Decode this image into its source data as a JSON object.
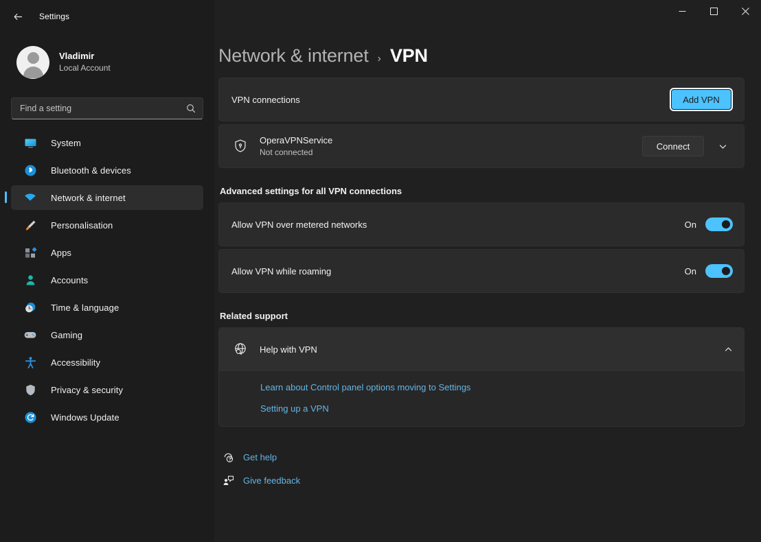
{
  "window": {
    "title": "Settings",
    "back_icon": "back-arrow-icon",
    "minimize_label": "Minimize",
    "maximize_label": "Maximize",
    "close_label": "Close"
  },
  "profile": {
    "name": "Vladimir",
    "account_type": "Local Account",
    "avatar_icon": "user-avatar-icon"
  },
  "search": {
    "placeholder": "Find a setting",
    "value": "",
    "icon": "search-icon"
  },
  "sidebar": {
    "items": [
      {
        "label": "System",
        "icon": "system-monitor-icon",
        "selected": false
      },
      {
        "label": "Bluetooth & devices",
        "icon": "bluetooth-icon",
        "selected": false
      },
      {
        "label": "Network & internet",
        "icon": "wifi-icon",
        "selected": true
      },
      {
        "label": "Personalisation",
        "icon": "paintbrush-icon",
        "selected": false
      },
      {
        "label": "Apps",
        "icon": "apps-icon",
        "selected": false
      },
      {
        "label": "Accounts",
        "icon": "account-person-icon",
        "selected": false
      },
      {
        "label": "Time & language",
        "icon": "clock-globe-icon",
        "selected": false
      },
      {
        "label": "Gaming",
        "icon": "gamepad-icon",
        "selected": false
      },
      {
        "label": "Accessibility",
        "icon": "accessibility-person-icon",
        "selected": false
      },
      {
        "label": "Privacy & security",
        "icon": "shield-icon",
        "selected": false
      },
      {
        "label": "Windows Update",
        "icon": "update-refresh-icon",
        "selected": false
      }
    ]
  },
  "breadcrumb": {
    "parent": "Network & internet",
    "separator": "›",
    "current": "VPN"
  },
  "vpn_connections": {
    "title": "VPN connections",
    "add_button": "Add VPN"
  },
  "connection": {
    "icon": "vpn-shield-icon",
    "name": "OperaVPNService",
    "status": "Not connected",
    "connect_button": "Connect",
    "expand_icon": "chevron-down-icon"
  },
  "advanced": {
    "heading": "Advanced settings for all VPN connections",
    "settings": [
      {
        "label": "Allow VPN over metered networks",
        "state": "On"
      },
      {
        "label": "Allow VPN while roaming",
        "state": "On"
      }
    ]
  },
  "related_support": {
    "heading": "Related support",
    "expander": {
      "icon": "globe-search-icon",
      "title": "Help with VPN",
      "collapse_icon": "chevron-up-icon",
      "links": [
        "Learn about Control panel options moving to Settings",
        "Setting up a VPN"
      ]
    }
  },
  "footer": {
    "links": [
      {
        "label": "Get help",
        "icon": "help-question-icon"
      },
      {
        "label": "Give feedback",
        "icon": "feedback-person-icon"
      }
    ]
  },
  "colors": {
    "accent": "#4cc2ff",
    "link": "#62b6e8",
    "page_bg": "#202020",
    "sidebar_bg": "#1c1c1c",
    "card_bg": "#2b2b2b"
  }
}
